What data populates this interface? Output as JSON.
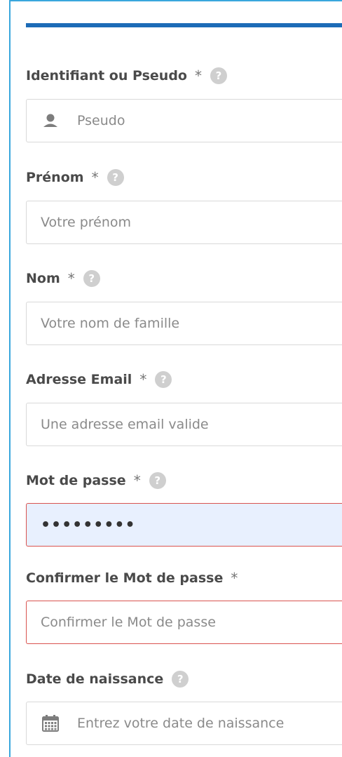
{
  "form": {
    "fields": [
      {
        "label": "Identifiant ou Pseudo",
        "required": "*",
        "help": "?",
        "placeholder": "Pseudo",
        "icon": "user-icon"
      },
      {
        "label": "Prénom",
        "required": "*",
        "help": "?",
        "placeholder": "Votre prénom"
      },
      {
        "label": "Nom",
        "required": "*",
        "help": "?",
        "placeholder": "Votre nom de famille"
      },
      {
        "label": "Adresse Email",
        "required": "*",
        "help": "?",
        "placeholder": "Une adresse email valide"
      },
      {
        "label": "Mot de passe",
        "required": "*",
        "help": "?",
        "value": "•••••••••",
        "state": "invalid-autofilled"
      },
      {
        "label": "Confirmer le Mot de passe",
        "required": "*",
        "placeholder": "Confirmer le Mot de passe",
        "state": "invalid"
      },
      {
        "label": "Date de naissance",
        "help": "?",
        "placeholder": "Entrez votre date de naissance",
        "icon": "calendar-icon"
      }
    ]
  },
  "colors": {
    "frame_border": "#39a7dd",
    "top_bar": "#1c6bb7",
    "invalid_border": "#d9534f",
    "autofill_bg": "#e8f0fe"
  }
}
